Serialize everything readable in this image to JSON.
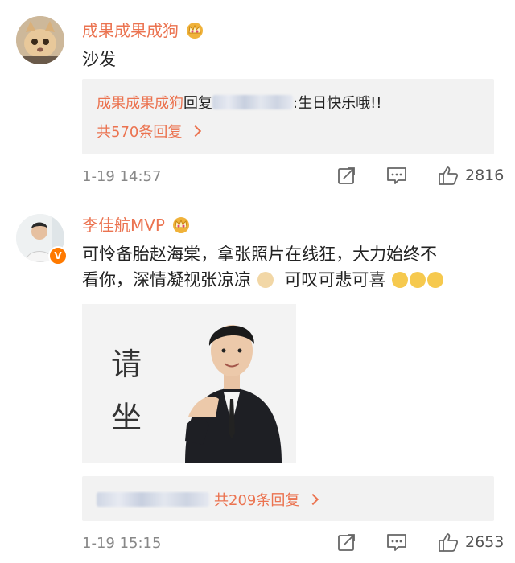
{
  "comments": [
    {
      "username": "成果成果成狗",
      "text": "沙发",
      "reply": {
        "author": "成果成果成狗",
        "reply_word": "回复",
        "message": ":生日快乐哦!!",
        "count_label": "共570条回复"
      },
      "time": "1-19 14:57",
      "likes": "2816"
    },
    {
      "username": "李佳航MVP",
      "text_line1": "可怜备胎赵海棠，拿张照片在线狂，大力始终不",
      "text_line2a": "看你，深情凝视张凉凉",
      "text_line2b": "可叹可悲可喜",
      "photo_text": [
        "请",
        "坐"
      ],
      "reply": {
        "count_label": "共209条回复"
      },
      "time": "1-19 15:15",
      "likes": "2653"
    }
  ],
  "icons": [
    "crown-icon",
    "share-icon",
    "comment-icon",
    "like-icon",
    "chevron-right-icon",
    "verified-badge-icon"
  ],
  "colors": {
    "accent": "#eb7350",
    "reply_bg": "#f2f2f2",
    "meta": "#888888"
  }
}
